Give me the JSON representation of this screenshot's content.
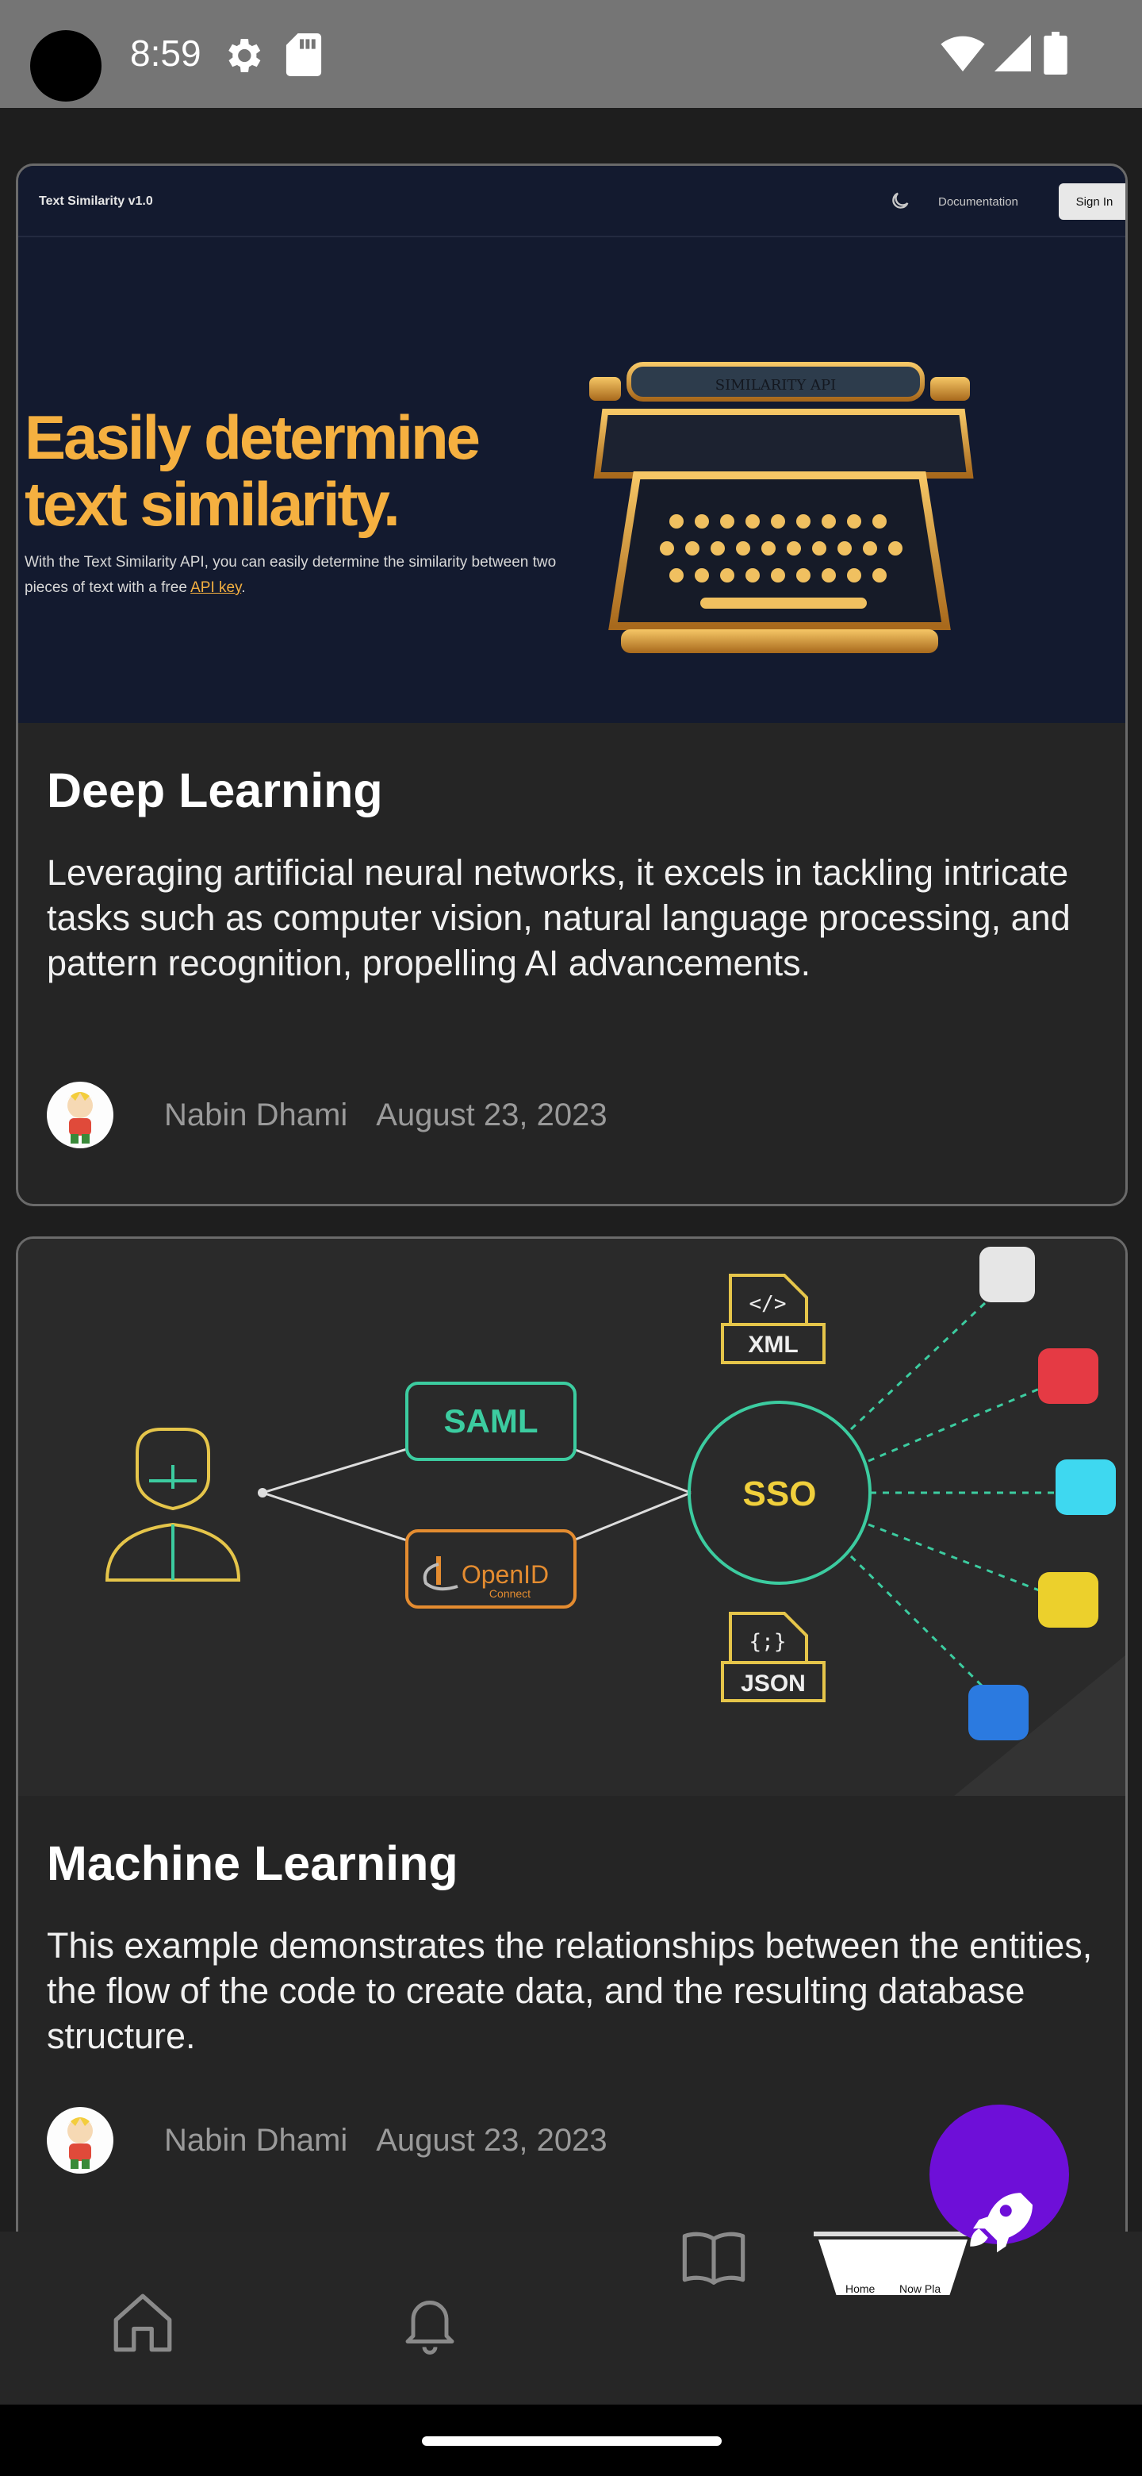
{
  "status_bar": {
    "time": "8:59"
  },
  "feed": {
    "cards": [
      {
        "title": "Deep Learning",
        "description": "Leveraging artificial neural networks, it excels in tackling intricate tasks such as computer vision, natural language processing, and pattern recognition, propelling AI advancements.",
        "author": "Nabin Dhami",
        "date": "August 23, 2023",
        "thumbnail": {
          "brand": "Text Similarity v1.0",
          "documentation": "Documentation",
          "sign_in": "Sign In",
          "headline_line1": "Easily determine",
          "headline_line2": "text similarity.",
          "subtext": "With the Text Similarity API, you can easily determine the similarity between two pieces of text with a free",
          "link": "API key",
          "subtext_end": ".",
          "typewriter_label": "SIMILARITY API"
        }
      },
      {
        "title": "Machine Learning",
        "description": "This example demonstrates the relationships between the entities, the flow of the code to create data, and the resulting database structure.",
        "author": "Nabin Dhami",
        "date": "August 23, 2023",
        "thumbnail": {
          "saml": "SAML",
          "openid": "OpenID",
          "openid_sub": "Connect",
          "sso": "SSO",
          "xml": "XML",
          "xml_tag": "</>",
          "json": "JSON",
          "json_tag": "{;}"
        }
      }
    ]
  },
  "bottom_nav": {
    "items": [
      "home-icon",
      "bell-icon",
      "book-icon",
      "now-playing-thumb"
    ],
    "active_preview": {
      "home": "Home",
      "now_playing": "Now Pla"
    }
  },
  "colors": {
    "status_bar": "#757575",
    "background": "#1e1e1e",
    "card": "#252525",
    "fab": "#6e0fd8",
    "headline_accent": "#f5b040"
  }
}
